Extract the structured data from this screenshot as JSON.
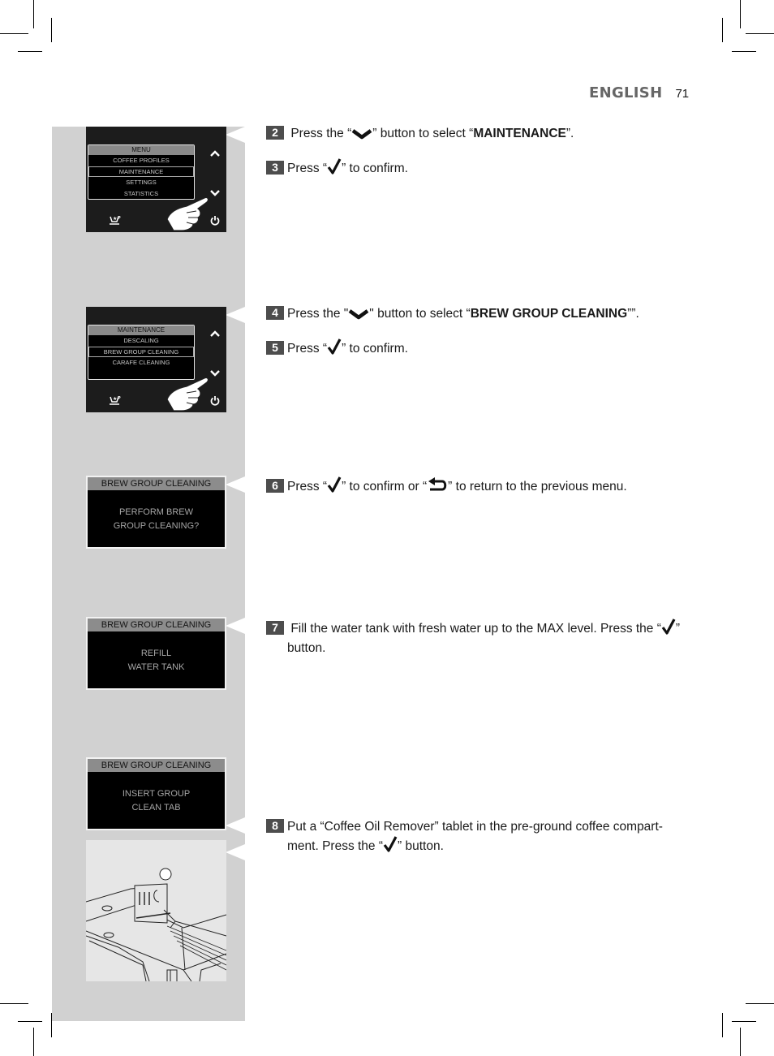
{
  "header": {
    "language": "ENGLISH",
    "page_number": "71"
  },
  "screens": [
    {
      "type": "menu",
      "title": "MENU",
      "items": [
        "COFFEE PROFILES",
        "MAINTENANCE",
        "SETTINGS",
        "STATISTICS"
      ],
      "selected_index": 1,
      "icons": [
        "chevron-up-icon",
        "chevron-down-icon",
        "coffee-profile-icon",
        "power-icon",
        "pointing-hand-icon"
      ]
    },
    {
      "type": "menu",
      "title": "MAINTENANCE",
      "items": [
        "DESCALING",
        "BREW GROUP CLEANING",
        "CARAFE CLEANING"
      ],
      "selected_index": 1,
      "icons": [
        "chevron-up-icon",
        "chevron-down-icon",
        "coffee-profile-icon",
        "power-icon",
        "pointing-hand-icon"
      ]
    },
    {
      "type": "message",
      "title": "BREW GROUP CLEANING",
      "lines": [
        "PERFORM BREW",
        "GROUP CLEANING?"
      ]
    },
    {
      "type": "message",
      "title": "BREW GROUP CLEANING",
      "lines": [
        "REFILL",
        "WATER TANK"
      ]
    },
    {
      "type": "message",
      "title": "BREW GROUP CLEANING",
      "lines": [
        "INSERT GROUP",
        "CLEAN TAB"
      ]
    }
  ],
  "illustration": {
    "subject": "coffee machine pre-ground coffee compartment with tablet"
  },
  "steps": [
    {
      "number": "2",
      "pre": "Press the “",
      "icon": "chevron-down-icon",
      "mid": "” button to select “",
      "bold": "MAINTENANCE",
      "post": "”."
    },
    {
      "number": "3",
      "pre": "Press “",
      "icon": "checkmark-icon",
      "post": "” to confirm."
    },
    {
      "number": "4",
      "pre": "Press the \"",
      "icon": "chevron-down-icon",
      "mid": "\" button to select “",
      "bold": "BREW GROUP CLEANING",
      "post": "””."
    },
    {
      "number": "5",
      "pre": "Press “",
      "icon": "checkmark-icon",
      "post": "” to confirm."
    },
    {
      "number": "6",
      "pre": "Press “",
      "icon": "checkmark-icon",
      "mid": "” to confirm or “",
      "icon2": "return-arrow-icon",
      "post": "” to return to the previous menu."
    },
    {
      "number": "7",
      "pre": "Fill the water tank with fresh water up to the MAX level. Press the “",
      "icon": "checkmark-icon",
      "post": "”",
      "line2": "button."
    },
    {
      "number": "8",
      "pre": "Put a “Coffee Oil Remover” tablet in the pre-ground coffee compart-",
      "line2_pre": "ment. Press the “",
      "icon": "checkmark-icon",
      "line2_post": "” button."
    }
  ]
}
